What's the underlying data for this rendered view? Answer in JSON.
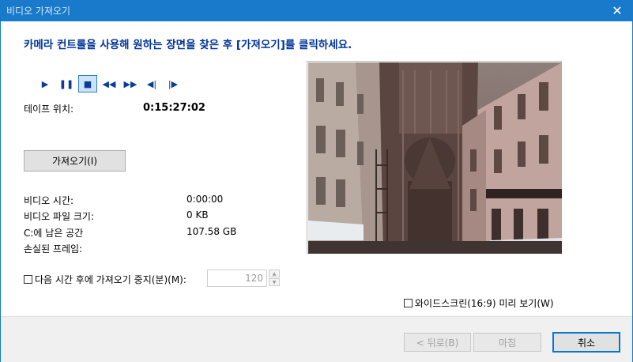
{
  "window": {
    "title": "비디오 가져오기",
    "close_glyph": "✕"
  },
  "heading": "카메라 컨트롤을 사용해 원하는 장면을 찾은 후 [가져오기]를 클릭하세요.",
  "controls": {
    "play": "▶",
    "pause": "❚❚",
    "stop": "■",
    "rewind": "◀◀",
    "fast_forward": "▶▶",
    "prev_frame": "◀|",
    "next_frame": "|▶"
  },
  "tape": {
    "label": "테이프 위치:",
    "value": "0:15:27:02"
  },
  "import_button": "가져오기(I)",
  "info": {
    "video_time_label": "비디오 시간:",
    "video_time_value": "0:00:00",
    "file_size_label": "비디오 파일 크기:",
    "file_size_value": "0 KB",
    "free_space_label": "C:에 남은 공간",
    "free_space_value": "107.58 GB",
    "lost_frames_label": "손실된 프레임:"
  },
  "stop_after": {
    "label": "다음 시간 후에 가져오기 중지(분)(M):",
    "value": "120",
    "checked": false
  },
  "widescreen": {
    "label": "와이드스크린(16:9) 미리 보기(W)",
    "checked": false
  },
  "footer": {
    "back": "< 뒤로(B)",
    "finish": "마침",
    "cancel": "취소"
  },
  "colors": {
    "titlebar": "#1979ca",
    "heading": "#003399",
    "control": "#0b3c9a"
  }
}
